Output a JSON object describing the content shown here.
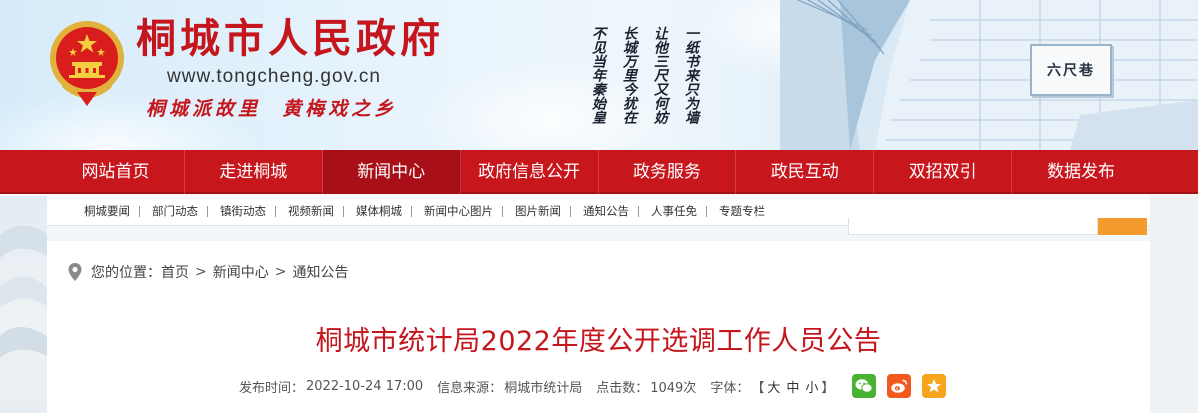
{
  "header": {
    "title": "桐城市人民政府",
    "url": "www.tongcheng.gov.cn",
    "slogan": "桐城派故里  黄梅戏之乡",
    "poem_columns": [
      "一纸书来只为墙",
      "让他三尺又何妨",
      "长城万里今犹在",
      "不见当年秦始皇"
    ],
    "plaque": "六尺巷"
  },
  "nav": {
    "items": [
      "网站首页",
      "走进桐城",
      "新闻中心",
      "政府信息公开",
      "政务服务",
      "政民互动",
      "双招双引",
      "数据发布"
    ],
    "active_index": 2
  },
  "subnav": {
    "items": [
      "桐城要闻",
      "部门动态",
      "镇街动态",
      "视频新闻",
      "媒体桐城",
      "新闻中心图片",
      "图片新闻",
      "通知公告",
      "人事任免",
      "专题专栏"
    ]
  },
  "breadcrumb": {
    "prefix": "您的位置：",
    "items": [
      "首页",
      "新闻中心",
      "通知公告"
    ],
    "separator": ">"
  },
  "article": {
    "title": "桐城市统计局2022年度公开选调工作人员公告",
    "publish_label": "发布时间：",
    "publish_time": "2022-10-24 17:00",
    "source_label": "信息来源：",
    "source": "桐城市统计局",
    "clicks_label": "点击数：",
    "clicks": "1049次",
    "font_label": "字体：",
    "font_open": "【",
    "font_large": "大",
    "font_medium": "中",
    "font_small": "小",
    "font_close": "】"
  },
  "colors": {
    "brand_red": "#c8161d",
    "nav_active": "#a80f16",
    "title_red": "#c4161c",
    "search_orange": "#f39b2c",
    "wechat_green": "#49b233",
    "weibo_orange": "#f3591f",
    "favorite_yellow": "#f6a51c"
  },
  "icons": [
    "national-emblem-icon",
    "location-pin-icon",
    "wechat-icon",
    "weibo-icon",
    "favorite-star-icon"
  ]
}
